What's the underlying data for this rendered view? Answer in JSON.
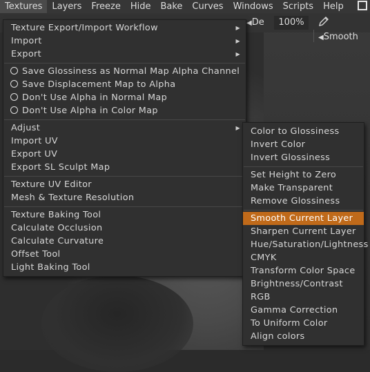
{
  "menubar": {
    "items": [
      "Textures",
      "Layers",
      "Freeze",
      "Hide",
      "Bake",
      "Curves",
      "Windows",
      "Scripts",
      "Help"
    ]
  },
  "toolbar": {
    "de_label": "De",
    "zoom_value": "100%",
    "smooth_label": "Smooth"
  },
  "main_menu": {
    "group1": [
      {
        "label": "Texture Export/Import Workflow",
        "submenu": true
      },
      {
        "label": "Import",
        "submenu": true
      },
      {
        "label": "Export",
        "submenu": true
      }
    ],
    "group2": [
      {
        "label": "Save Glossiness as Normal Map Alpha Channel"
      },
      {
        "label": "Save Displacement Map to Alpha"
      },
      {
        "label": "Don't Use Alpha in Normal Map"
      },
      {
        "label": "Don't Use Alpha in Color Map"
      }
    ],
    "group3": [
      {
        "label": "Adjust",
        "submenu": true
      },
      {
        "label": "Import UV"
      },
      {
        "label": "Export UV"
      },
      {
        "label": "Export SL Sculpt Map"
      }
    ],
    "group4": [
      {
        "label": "Texture UV Editor"
      },
      {
        "label": "Mesh & Texture Resolution"
      }
    ],
    "group5": [
      {
        "label": "Texture Baking Tool"
      },
      {
        "label": "Calculate Occlusion"
      },
      {
        "label": "Calculate Curvature"
      },
      {
        "label": "Offset Tool"
      },
      {
        "label": "Light Baking Tool"
      }
    ]
  },
  "adjust_submenu": {
    "group1": [
      "Color to Glossiness",
      "Invert Color",
      "Invert Glossiness"
    ],
    "group2": [
      "Set Height to Zero",
      "Make Transparent",
      "Remove Glossiness"
    ],
    "group3": [
      "Smooth Current Layer",
      "Sharpen Current Layer",
      "Hue/Saturation/Lightness",
      "CMYK",
      "Transform Color Space",
      "Brightness/Contrast",
      "RGB",
      "Gamma Correction",
      "To Uniform Color",
      "Align colors"
    ],
    "highlighted": "Smooth Current Layer"
  },
  "colors": {
    "highlight": "#c06a1a",
    "menu_bg": "#303030"
  }
}
